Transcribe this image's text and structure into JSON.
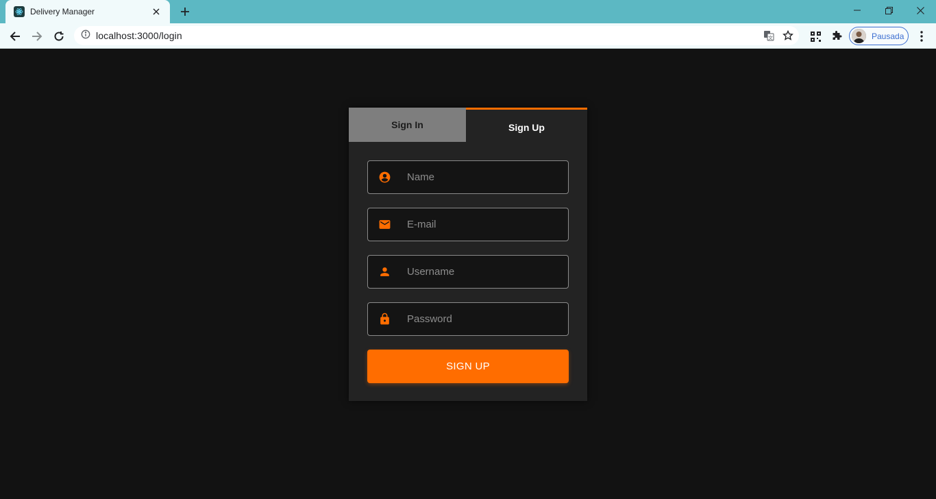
{
  "browser": {
    "tab_title": "Delivery Manager",
    "url": "localhost:3000/login",
    "profile_name": "Pausada"
  },
  "auth": {
    "tabs": [
      {
        "label": "Sign In",
        "active": false
      },
      {
        "label": "Sign Up",
        "active": true
      }
    ],
    "fields": {
      "name": {
        "placeholder": "Name",
        "icon": "account-circle-icon"
      },
      "email": {
        "placeholder": "E-mail",
        "icon": "mail-icon"
      },
      "username": {
        "placeholder": "Username",
        "icon": "person-icon"
      },
      "password": {
        "placeholder": "Password",
        "icon": "lock-icon"
      }
    },
    "submit_label": "SIGN UP"
  },
  "colors": {
    "accent": "#ff6d00",
    "background": "#121212",
    "card": "#232323",
    "inactive_tab": "#7e7e7e",
    "chrome_frame": "#5cb8c3"
  }
}
